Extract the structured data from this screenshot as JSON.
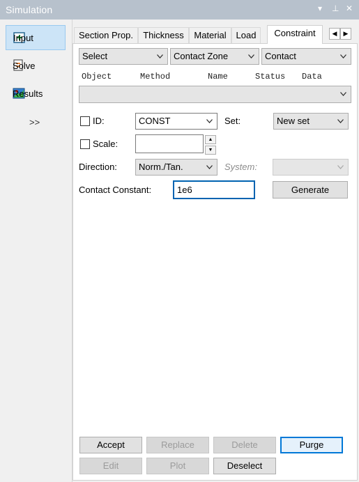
{
  "window": {
    "title": "Simulation",
    "controls": [
      "▾",
      "⊥",
      "✕"
    ]
  },
  "sidebar": {
    "items": [
      {
        "label": "Input",
        "active": true,
        "icon": "input-icon"
      },
      {
        "label": "Solve",
        "active": false,
        "icon": "solve-icon"
      },
      {
        "label": "Results",
        "active": false,
        "icon": "results-icon"
      }
    ],
    "more_label": ">>"
  },
  "tabs": {
    "items": [
      "Section Prop.",
      "Thickness",
      "Material",
      "Load",
      "Constraint"
    ],
    "active": "Constraint",
    "scroll_left": "◀",
    "scroll_right": "▶"
  },
  "filters": {
    "select": "Select",
    "zone": "Contact Zone",
    "type": "Contact"
  },
  "list_columns": [
    "Object",
    "Method",
    "Name",
    "Status",
    "Data"
  ],
  "form": {
    "id_label": "ID:",
    "id_value": "CONST",
    "set_label": "Set:",
    "set_value": "New set",
    "scale_label": "Scale:",
    "scale_value": "",
    "direction_label": "Direction:",
    "direction_value": "Norm./Tan.",
    "system_label": "System:",
    "system_value": "",
    "contact_constant_label": "Contact Constant:",
    "contact_constant_value": "1e6",
    "generate_label": "Generate"
  },
  "buttons": {
    "accept": "Accept",
    "replace": "Replace",
    "delete": "Delete",
    "purge": "Purge",
    "edit": "Edit",
    "plot": "Plot",
    "deselect": "Deselect"
  },
  "colors": {
    "titlebar": "#b7c1cc",
    "accent": "#0078d7",
    "selection": "#cce4f7"
  }
}
